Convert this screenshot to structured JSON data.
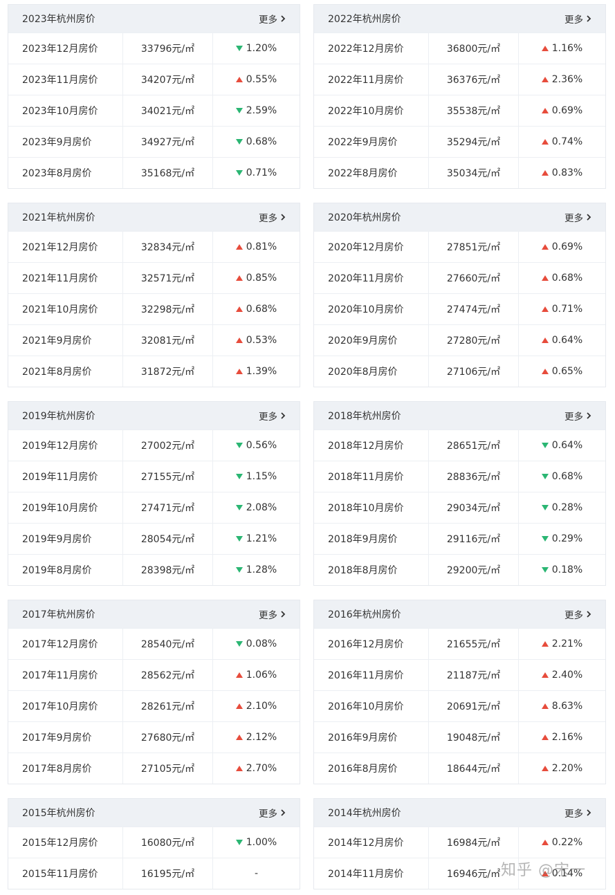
{
  "colors": {
    "up": "#e74c3c",
    "down": "#2bb673",
    "header_bg": "#eef1f5"
  },
  "more_label": "更多",
  "watermark": "知乎 @宋一",
  "cards": [
    {
      "title": "2023年杭州房价",
      "rows": [
        {
          "label": "2023年12月房价",
          "price": "33796元/㎡",
          "dir": "down",
          "change": "1.20%"
        },
        {
          "label": "2023年11月房价",
          "price": "34207元/㎡",
          "dir": "up",
          "change": "0.55%"
        },
        {
          "label": "2023年10月房价",
          "price": "34021元/㎡",
          "dir": "down",
          "change": "2.59%"
        },
        {
          "label": "2023年9月房价",
          "price": "34927元/㎡",
          "dir": "down",
          "change": "0.68%"
        },
        {
          "label": "2023年8月房价",
          "price": "35168元/㎡",
          "dir": "down",
          "change": "0.71%"
        }
      ]
    },
    {
      "title": "2022年杭州房价",
      "rows": [
        {
          "label": "2022年12月房价",
          "price": "36800元/㎡",
          "dir": "up",
          "change": "1.16%"
        },
        {
          "label": "2022年11月房价",
          "price": "36376元/㎡",
          "dir": "up",
          "change": "2.36%"
        },
        {
          "label": "2022年10月房价",
          "price": "35538元/㎡",
          "dir": "up",
          "change": "0.69%"
        },
        {
          "label": "2022年9月房价",
          "price": "35294元/㎡",
          "dir": "up",
          "change": "0.74%"
        },
        {
          "label": "2022年8月房价",
          "price": "35034元/㎡",
          "dir": "up",
          "change": "0.83%"
        }
      ]
    },
    {
      "title": "2021年杭州房价",
      "rows": [
        {
          "label": "2021年12月房价",
          "price": "32834元/㎡",
          "dir": "up",
          "change": "0.81%"
        },
        {
          "label": "2021年11月房价",
          "price": "32571元/㎡",
          "dir": "up",
          "change": "0.85%"
        },
        {
          "label": "2021年10月房价",
          "price": "32298元/㎡",
          "dir": "up",
          "change": "0.68%"
        },
        {
          "label": "2021年9月房价",
          "price": "32081元/㎡",
          "dir": "up",
          "change": "0.53%"
        },
        {
          "label": "2021年8月房价",
          "price": "31872元/㎡",
          "dir": "up",
          "change": "1.39%"
        }
      ]
    },
    {
      "title": "2020年杭州房价",
      "rows": [
        {
          "label": "2020年12月房价",
          "price": "27851元/㎡",
          "dir": "up",
          "change": "0.69%"
        },
        {
          "label": "2020年11月房价",
          "price": "27660元/㎡",
          "dir": "up",
          "change": "0.68%"
        },
        {
          "label": "2020年10月房价",
          "price": "27474元/㎡",
          "dir": "up",
          "change": "0.71%"
        },
        {
          "label": "2020年9月房价",
          "price": "27280元/㎡",
          "dir": "up",
          "change": "0.64%"
        },
        {
          "label": "2020年8月房价",
          "price": "27106元/㎡",
          "dir": "up",
          "change": "0.65%"
        }
      ]
    },
    {
      "title": "2019年杭州房价",
      "rows": [
        {
          "label": "2019年12月房价",
          "price": "27002元/㎡",
          "dir": "down",
          "change": "0.56%"
        },
        {
          "label": "2019年11月房价",
          "price": "27155元/㎡",
          "dir": "down",
          "change": "1.15%"
        },
        {
          "label": "2019年10月房价",
          "price": "27471元/㎡",
          "dir": "down",
          "change": "2.08%"
        },
        {
          "label": "2019年9月房价",
          "price": "28054元/㎡",
          "dir": "down",
          "change": "1.21%"
        },
        {
          "label": "2019年8月房价",
          "price": "28398元/㎡",
          "dir": "down",
          "change": "1.28%"
        }
      ]
    },
    {
      "title": "2018年杭州房价",
      "rows": [
        {
          "label": "2018年12月房价",
          "price": "28651元/㎡",
          "dir": "down",
          "change": "0.64%"
        },
        {
          "label": "2018年11月房价",
          "price": "28836元/㎡",
          "dir": "down",
          "change": "0.68%"
        },
        {
          "label": "2018年10月房价",
          "price": "29034元/㎡",
          "dir": "down",
          "change": "0.28%"
        },
        {
          "label": "2018年9月房价",
          "price": "29116元/㎡",
          "dir": "down",
          "change": "0.29%"
        },
        {
          "label": "2018年8月房价",
          "price": "29200元/㎡",
          "dir": "down",
          "change": "0.18%"
        }
      ]
    },
    {
      "title": "2017年杭州房价",
      "rows": [
        {
          "label": "2017年12月房价",
          "price": "28540元/㎡",
          "dir": "down",
          "change": "0.08%"
        },
        {
          "label": "2017年11月房价",
          "price": "28562元/㎡",
          "dir": "up",
          "change": "1.06%"
        },
        {
          "label": "2017年10月房价",
          "price": "28261元/㎡",
          "dir": "up",
          "change": "2.10%"
        },
        {
          "label": "2017年9月房价",
          "price": "27680元/㎡",
          "dir": "up",
          "change": "2.12%"
        },
        {
          "label": "2017年8月房价",
          "price": "27105元/㎡",
          "dir": "up",
          "change": "2.70%"
        }
      ]
    },
    {
      "title": "2016年杭州房价",
      "rows": [
        {
          "label": "2016年12月房价",
          "price": "21655元/㎡",
          "dir": "up",
          "change": "2.21%"
        },
        {
          "label": "2016年11月房价",
          "price": "21187元/㎡",
          "dir": "up",
          "change": "2.40%"
        },
        {
          "label": "2016年10月房价",
          "price": "20691元/㎡",
          "dir": "up",
          "change": "8.63%"
        },
        {
          "label": "2016年9月房价",
          "price": "19048元/㎡",
          "dir": "up",
          "change": "2.16%"
        },
        {
          "label": "2016年8月房价",
          "price": "18644元/㎡",
          "dir": "up",
          "change": "2.20%"
        }
      ]
    },
    {
      "title": "2015年杭州房价",
      "rows": [
        {
          "label": "2015年12月房价",
          "price": "16080元/㎡",
          "dir": "down",
          "change": "1.00%"
        },
        {
          "label": "2015年11月房价",
          "price": "16195元/㎡",
          "dir": "none",
          "change": "-"
        }
      ]
    },
    {
      "title": "2014年杭州房价",
      "rows": [
        {
          "label": "2014年12月房价",
          "price": "16984元/㎡",
          "dir": "up",
          "change": "0.22%"
        },
        {
          "label": "2014年11月房价",
          "price": "16946元/㎡",
          "dir": "up",
          "change": "0.14%"
        }
      ]
    }
  ]
}
